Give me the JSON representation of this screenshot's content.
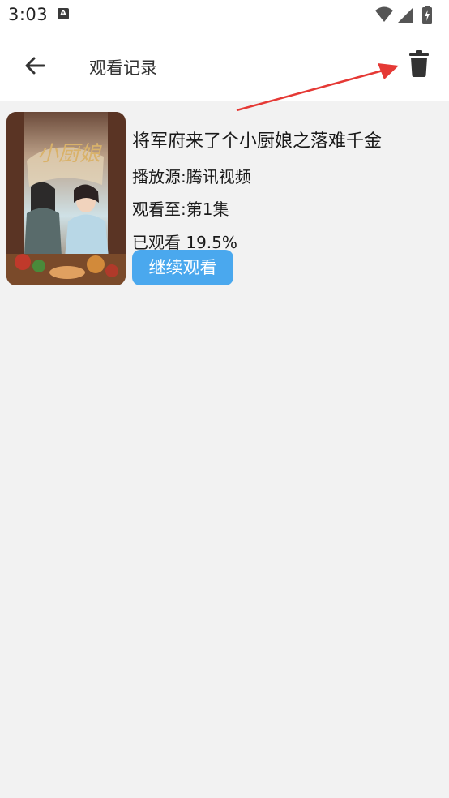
{
  "status_bar": {
    "time": "3:03",
    "notification_icon": "a-icon",
    "icons": [
      "wifi-icon",
      "signal-icon",
      "battery-charging-icon"
    ]
  },
  "header": {
    "back_icon": "arrow-left-icon",
    "title": "观看记录",
    "delete_icon": "trash-icon"
  },
  "annotation": {
    "arrow_color": "#e53935"
  },
  "history": [
    {
      "title": "将军府来了个小厨娘之落难千金",
      "source": "播放源:腾讯视频",
      "episode": "观看至:第1集",
      "progress": "已观看 19.5%",
      "continue_label": "继续观看"
    }
  ],
  "colors": {
    "accent": "#4aa8ee",
    "background": "#f2f2f2",
    "bar": "#ffffff"
  }
}
